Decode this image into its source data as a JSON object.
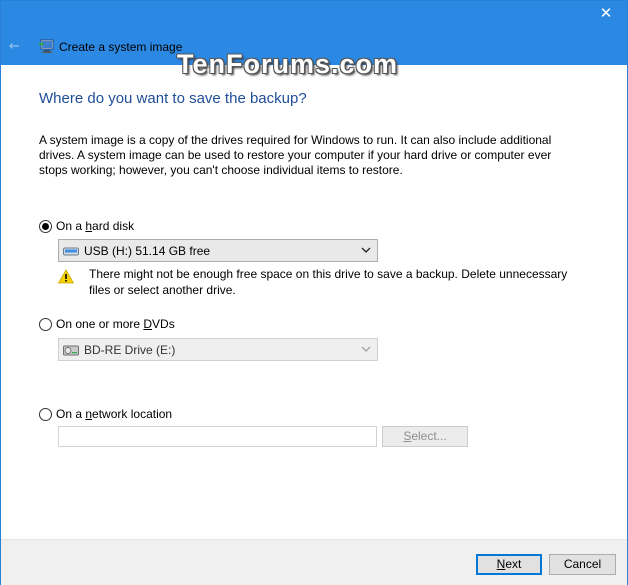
{
  "window": {
    "title": "Create a system image",
    "close_glyph": "✕",
    "back_glyph": "←",
    "watermark": "TenForums.com"
  },
  "page": {
    "heading": "Where do you want to save the backup?",
    "description": "A system image is a copy of the drives required for Windows to run. It can also include additional drives. A system image can be used to restore your computer if your hard drive or computer ever stops working; however, you can't choose individual items to restore."
  },
  "options": {
    "hard_disk": {
      "label_prefix": "On a ",
      "label_accel": "h",
      "label_suffix": "ard disk",
      "selected": true,
      "drive": "USB (H:)  51.14 GB free",
      "warning": "There might not be enough free space on this drive to save a backup. Delete unnecessary files or select another drive."
    },
    "dvd": {
      "label_prefix": "On one or more ",
      "label_accel": "D",
      "label_suffix": "VDs",
      "selected": false,
      "drive": "BD-RE Drive (E:)"
    },
    "network": {
      "label_prefix": "On a ",
      "label_accel": "n",
      "label_suffix": "etwork location",
      "selected": false,
      "path_value": "",
      "select_label_accel": "S",
      "select_label_rest": "elect..."
    }
  },
  "footer": {
    "next_accel": "N",
    "next_rest": "ext",
    "cancel_label": "Cancel"
  },
  "colors": {
    "titlebar": "#2b88e3",
    "heading": "#1f4e99",
    "primary_border": "#0078d7"
  }
}
